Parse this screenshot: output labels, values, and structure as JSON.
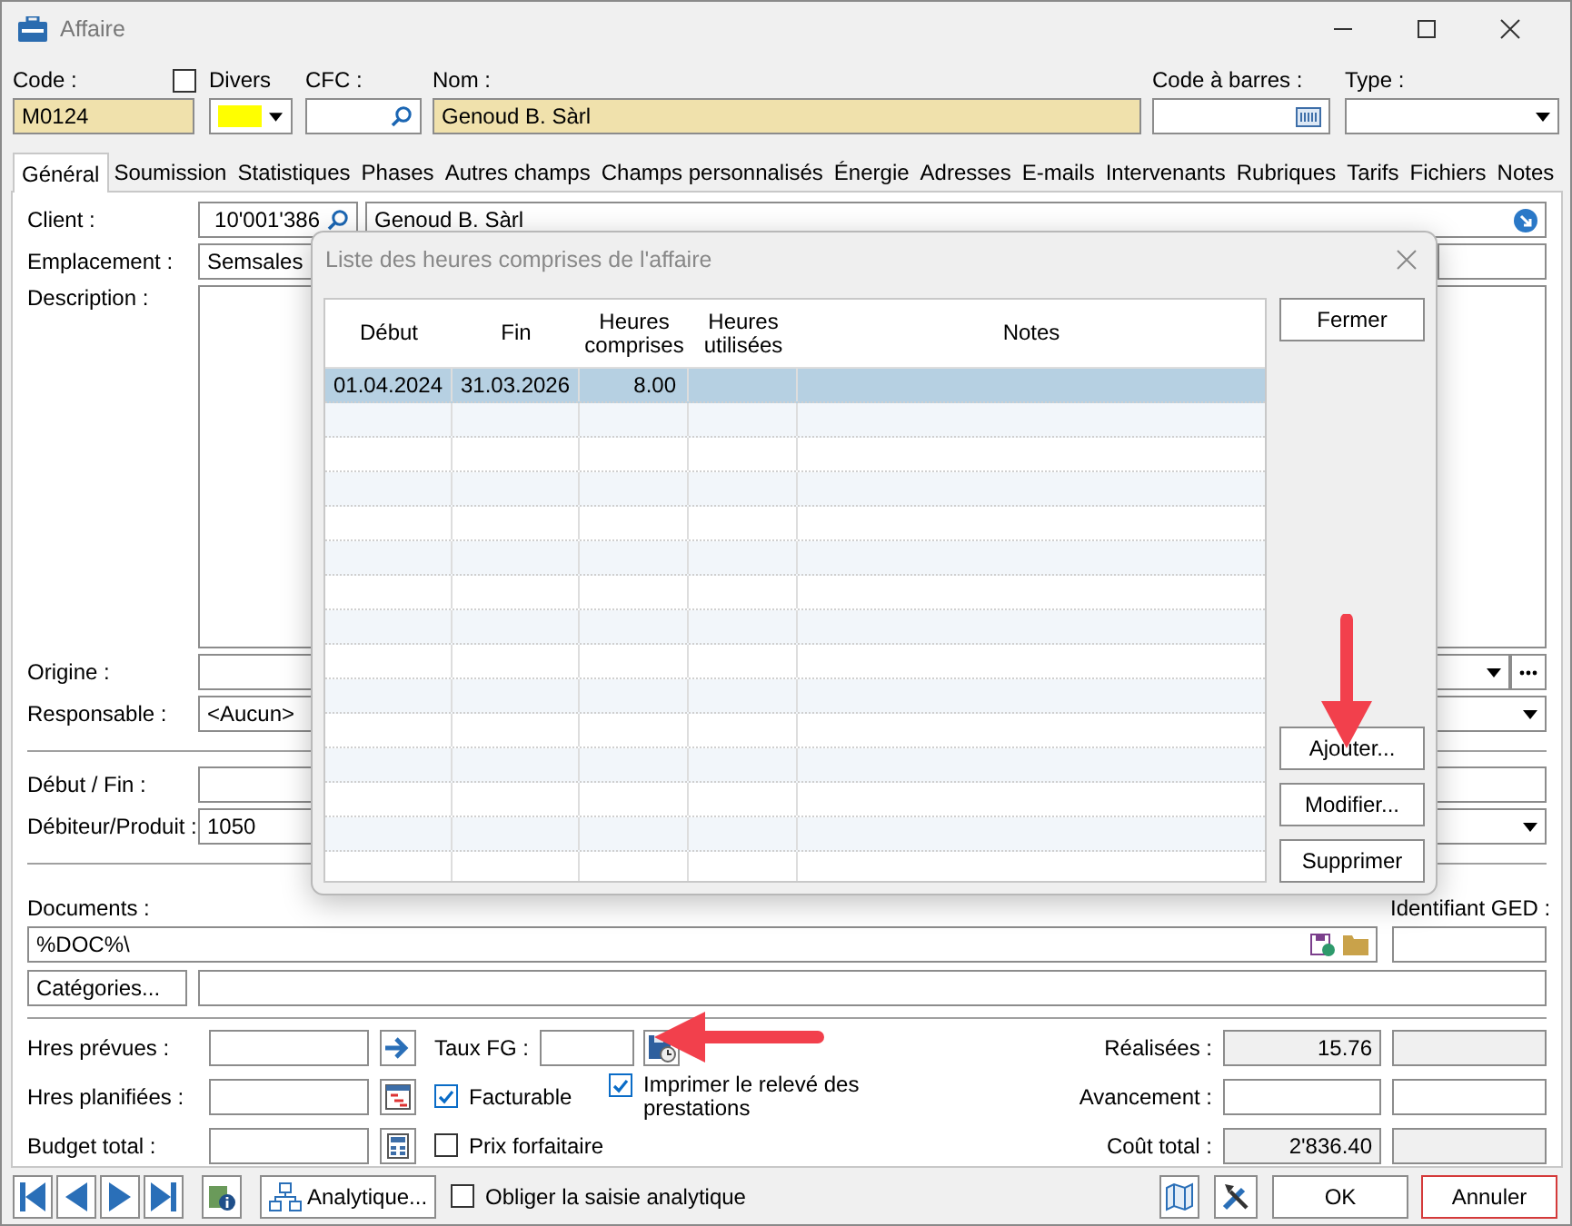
{
  "window": {
    "title": "Affaire"
  },
  "header": {
    "code": {
      "label": "Code :",
      "value": "M0124"
    },
    "divers": {
      "label": "Divers",
      "checked": false,
      "color": "#ffff00"
    },
    "cfc": {
      "label": "CFC :"
    },
    "nom": {
      "label": "Nom :",
      "value": "Genoud B. Sàrl"
    },
    "barcode": {
      "label": "Code à barres :"
    },
    "type": {
      "label": "Type :"
    }
  },
  "tabs": [
    {
      "label": "Général",
      "selected": true
    },
    {
      "label": "Soumission",
      "selected": false
    },
    {
      "label": "Statistiques",
      "selected": false
    },
    {
      "label": "Phases",
      "selected": false
    },
    {
      "label": "Autres champs",
      "selected": false
    },
    {
      "label": "Champs personnalisés",
      "selected": false
    },
    {
      "label": "Énergie",
      "selected": false
    },
    {
      "label": "Adresses",
      "selected": false
    },
    {
      "label": "E-mails",
      "selected": false
    },
    {
      "label": "Intervenants",
      "selected": false
    },
    {
      "label": "Rubriques",
      "selected": false
    },
    {
      "label": "Tarifs",
      "selected": false
    },
    {
      "label": "Fichiers",
      "selected": false
    },
    {
      "label": "Notes",
      "selected": false
    }
  ],
  "form": {
    "client": {
      "label": "Client :",
      "number": "10'001'386",
      "name": "Genoud B. Sàrl"
    },
    "emplacement": {
      "label": "Emplacement :",
      "value": "Semsales"
    },
    "description": {
      "label": "Description :"
    },
    "origine": {
      "label": "Origine :"
    },
    "responsable": {
      "label": "Responsable :",
      "value": "<Aucun>"
    },
    "debut_fin": {
      "label": "Début / Fin :"
    },
    "debiteur": {
      "label": "Débiteur/Produit :",
      "value": "1050"
    },
    "documents": {
      "label": "Documents :",
      "value": "%DOC%\\"
    },
    "ged": {
      "label": "Identifiant GED :"
    },
    "categories_button": "Catégories..."
  },
  "hours": {
    "prevues": "Hres prévues :",
    "planifiees": "Hres planifiées :",
    "budget": "Budget total :",
    "taux": "Taux FG :",
    "checks": [
      {
        "label": "Facturable",
        "checked": true
      },
      {
        "label": "Imprimer le relevé des prestations",
        "checked": true
      },
      {
        "label": "Prix forfaitaire",
        "checked": false
      }
    ],
    "realisees": {
      "label": "Réalisées :",
      "value": "15.76"
    },
    "avancement": {
      "label": "Avancement :"
    },
    "cout": {
      "label": "Coût total :",
      "value": "2'836.40"
    }
  },
  "footer": {
    "analytique_button": "Analytique...",
    "obliger": {
      "label": "Obliger la saisie analytique",
      "checked": false
    },
    "ok": "OK",
    "cancel": "Annuler"
  },
  "dialog": {
    "title": "Liste des heures comprises de l'affaire",
    "columns": [
      "Début",
      "Fin",
      "Heures comprises",
      "Heures utilisées",
      "Notes"
    ],
    "rows": [
      {
        "debut": "01.04.2024",
        "fin": "31.03.2026",
        "heures_comprises": "8.00",
        "selected": true
      }
    ],
    "buttons": {
      "close": "Fermer",
      "add": "Ajouter...",
      "edit": "Modifier...",
      "delete": "Supprimer"
    }
  }
}
